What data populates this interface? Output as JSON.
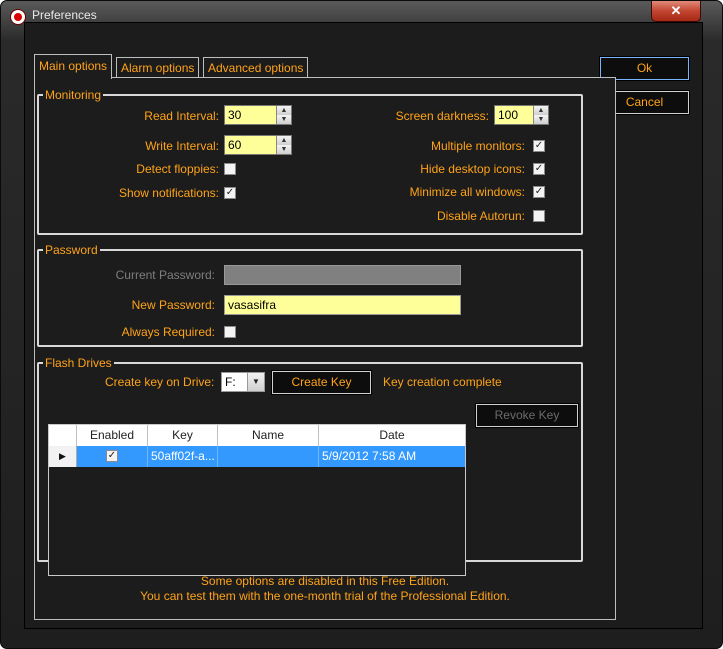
{
  "window": {
    "title": "Preferences",
    "close_glyph": "✕"
  },
  "tabs": [
    {
      "label": "Main options"
    },
    {
      "label": "Alarm options"
    },
    {
      "label": "Advanced options"
    }
  ],
  "buttons": {
    "ok": "Ok",
    "cancel": "Cancel"
  },
  "monitoring": {
    "title": "Monitoring",
    "read_interval_label": "Read Interval:",
    "read_interval_value": "30",
    "write_interval_label": "Write Interval:",
    "write_interval_value": "60",
    "detect_floppies_label": "Detect floppies:",
    "detect_floppies_checked": false,
    "show_notifications_label": "Show notifications:",
    "show_notifications_checked": true,
    "screen_darkness_label": "Screen darkness:",
    "screen_darkness_value": "100",
    "multiple_monitors_label": "Multiple monitors:",
    "multiple_monitors_checked": true,
    "hide_desktop_icons_label": "Hide desktop icons:",
    "hide_desktop_icons_checked": true,
    "minimize_all_windows_label": "Minimize all windows:",
    "minimize_all_windows_checked": true,
    "disable_autorun_label": "Disable Autorun:",
    "disable_autorun_checked": false
  },
  "password": {
    "title": "Password",
    "current_password_label": "Current Password:",
    "current_password_value": "",
    "new_password_label": "New Password:",
    "new_password_value": "vasasifra",
    "always_required_label": "Always Required:",
    "always_required_checked": false
  },
  "flash_drives": {
    "title": "Flash Drives",
    "create_key_on_drive_label": "Create key on Drive:",
    "drive_selected": "F:",
    "create_key_button": "Create Key",
    "status_text": "Key creation complete",
    "revoke_key_button": "Revoke Key",
    "columns": [
      "Enabled",
      "Key",
      "Name",
      "Date"
    ],
    "rows": [
      {
        "enabled": true,
        "key": "50aff02f-a...",
        "name": "",
        "date": "5/9/2012 7:58 AM"
      }
    ]
  },
  "footer": {
    "line1": "Some options are disabled in this Free Edition.",
    "line2": "You can test them with the one-month trial of the Professional Edition."
  },
  "icons": {
    "check": "✓",
    "spin_up": "▲",
    "spin_down": "▼",
    "dropdown": "▼",
    "row_pointer": "▶"
  }
}
